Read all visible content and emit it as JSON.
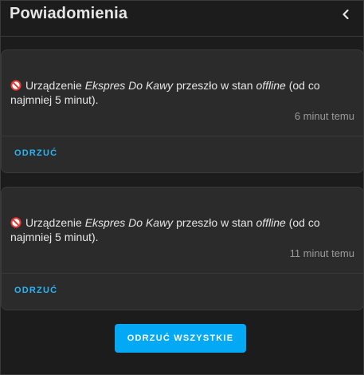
{
  "header": {
    "title": "Powiadomienia",
    "close_icon": "chevron-left-icon"
  },
  "notifications": [
    {
      "icon": "no-entry-icon",
      "text_before": "Urządzenie ",
      "device": "Ekspres Do Kawy",
      "text_middle": " przeszło w stan ",
      "state": "offline",
      "text_after": " (od co najmniej 5 minut).",
      "time": "6 minut temu",
      "dismiss_label": "ODRZUĆ"
    },
    {
      "icon": "no-entry-icon",
      "text_before": "Urządzenie ",
      "device": "Ekspres Do Kawy",
      "text_middle": " przeszło w stan ",
      "state": "offline",
      "text_after": " (od co najmniej 5 minut).",
      "time": "11 minut temu",
      "dismiss_label": "ODRZUĆ"
    }
  ],
  "dismiss_all_label": "ODRZUĆ WSZYSTKIE",
  "colors": {
    "accent": "#03a9f4",
    "link": "#29b6f6",
    "no_entry": "#e53935"
  }
}
